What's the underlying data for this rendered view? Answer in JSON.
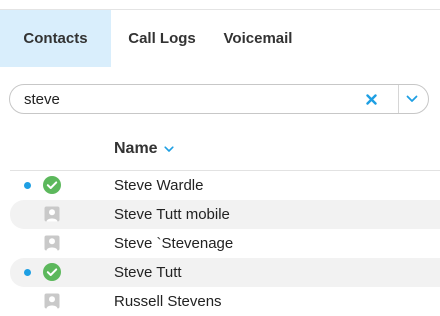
{
  "tabs": [
    {
      "label": "Contacts",
      "active": true
    },
    {
      "label": "Call Logs",
      "active": false
    },
    {
      "label": "Voicemail",
      "active": false
    }
  ],
  "search": {
    "value": "steve",
    "clear_icon": "close-icon",
    "dropdown_icon": "chevron-down-icon"
  },
  "list_header": {
    "name_label": "Name",
    "sort_icon": "chevron-down-icon"
  },
  "contacts": [
    {
      "name": "Steve Wardle",
      "status": "available",
      "status_icon": "check-circle-icon",
      "online_dot": true
    },
    {
      "name": "Steve Tutt mobile",
      "status": "none",
      "status_icon": "person-icon",
      "online_dot": false
    },
    {
      "name": "Steve `Stevenage",
      "status": "none",
      "status_icon": "person-icon",
      "online_dot": false
    },
    {
      "name": "Steve Tutt",
      "status": "available",
      "status_icon": "check-circle-icon",
      "online_dot": true
    },
    {
      "name": "Russell Stevens",
      "status": "none",
      "status_icon": "person-icon",
      "online_dot": false
    }
  ],
  "colors": {
    "accent": "#1e9fe3",
    "active_tab_bg": "#d9eefc",
    "available_green": "#5cb85c",
    "placeholder_gray": "#c9c9c9",
    "row_alt_bg": "#f2f2f2"
  }
}
